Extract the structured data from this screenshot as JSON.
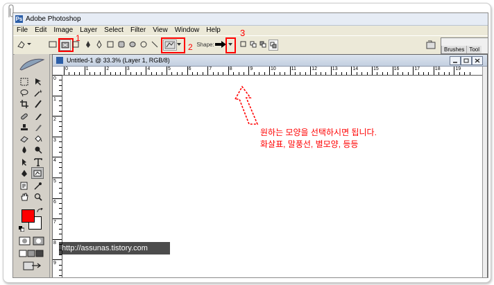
{
  "app": {
    "title": "Adobe Photoshop",
    "logo": "Ps"
  },
  "menubar": {
    "items": [
      "File",
      "Edit",
      "Image",
      "Layer",
      "Select",
      "Filter",
      "View",
      "Window",
      "Help"
    ]
  },
  "options": {
    "shape_label": "Shape:"
  },
  "palette_well": {
    "tabs": [
      "Brushes",
      "Tool"
    ]
  },
  "annotations": {
    "num1": "1",
    "num2": "2",
    "num3": "3"
  },
  "document": {
    "title": "Untitled-1 @ 33.3% (Layer 1, RGB/8)",
    "ruler_h": [
      "0",
      "1",
      "2",
      "3",
      "4",
      "5",
      "6",
      "7",
      "8",
      "9",
      "10",
      "11",
      "12",
      "13",
      "14",
      "15",
      "16",
      "17",
      "18",
      "19"
    ],
    "ruler_v": [
      "0",
      "1",
      "2",
      "3",
      "4",
      "5",
      "6",
      "7",
      "8",
      "9"
    ]
  },
  "callout": {
    "line1": "원하는 모양을 선택하시면 됩니다.",
    "line2": "화살표, 말풍선, 별모양, 등등"
  },
  "watermark": "http://assunas.tistory.com",
  "colors": {
    "foreground": "#ff0000",
    "background": "#ffffff",
    "accent_red": "#ff0000"
  },
  "icons": [
    "paperclip-icon",
    "photoshop-logo-icon",
    "custom-shape-icon",
    "arrow-shape-icon",
    "feather-icon",
    "marquee-icon",
    "move-icon",
    "lasso-icon",
    "magic-wand-icon",
    "crop-icon",
    "slice-icon",
    "healing-icon",
    "brush-icon",
    "stamp-icon",
    "history-brush-icon",
    "eraser-icon",
    "bucket-icon",
    "blur-icon",
    "dodge-icon",
    "path-select-icon",
    "type-icon",
    "pen-icon",
    "shape-tool-icon",
    "notes-icon",
    "eyedropper-icon",
    "hand-icon",
    "zoom-icon",
    "quickmask-icon",
    "screenmode-icon",
    "jump-icon"
  ]
}
